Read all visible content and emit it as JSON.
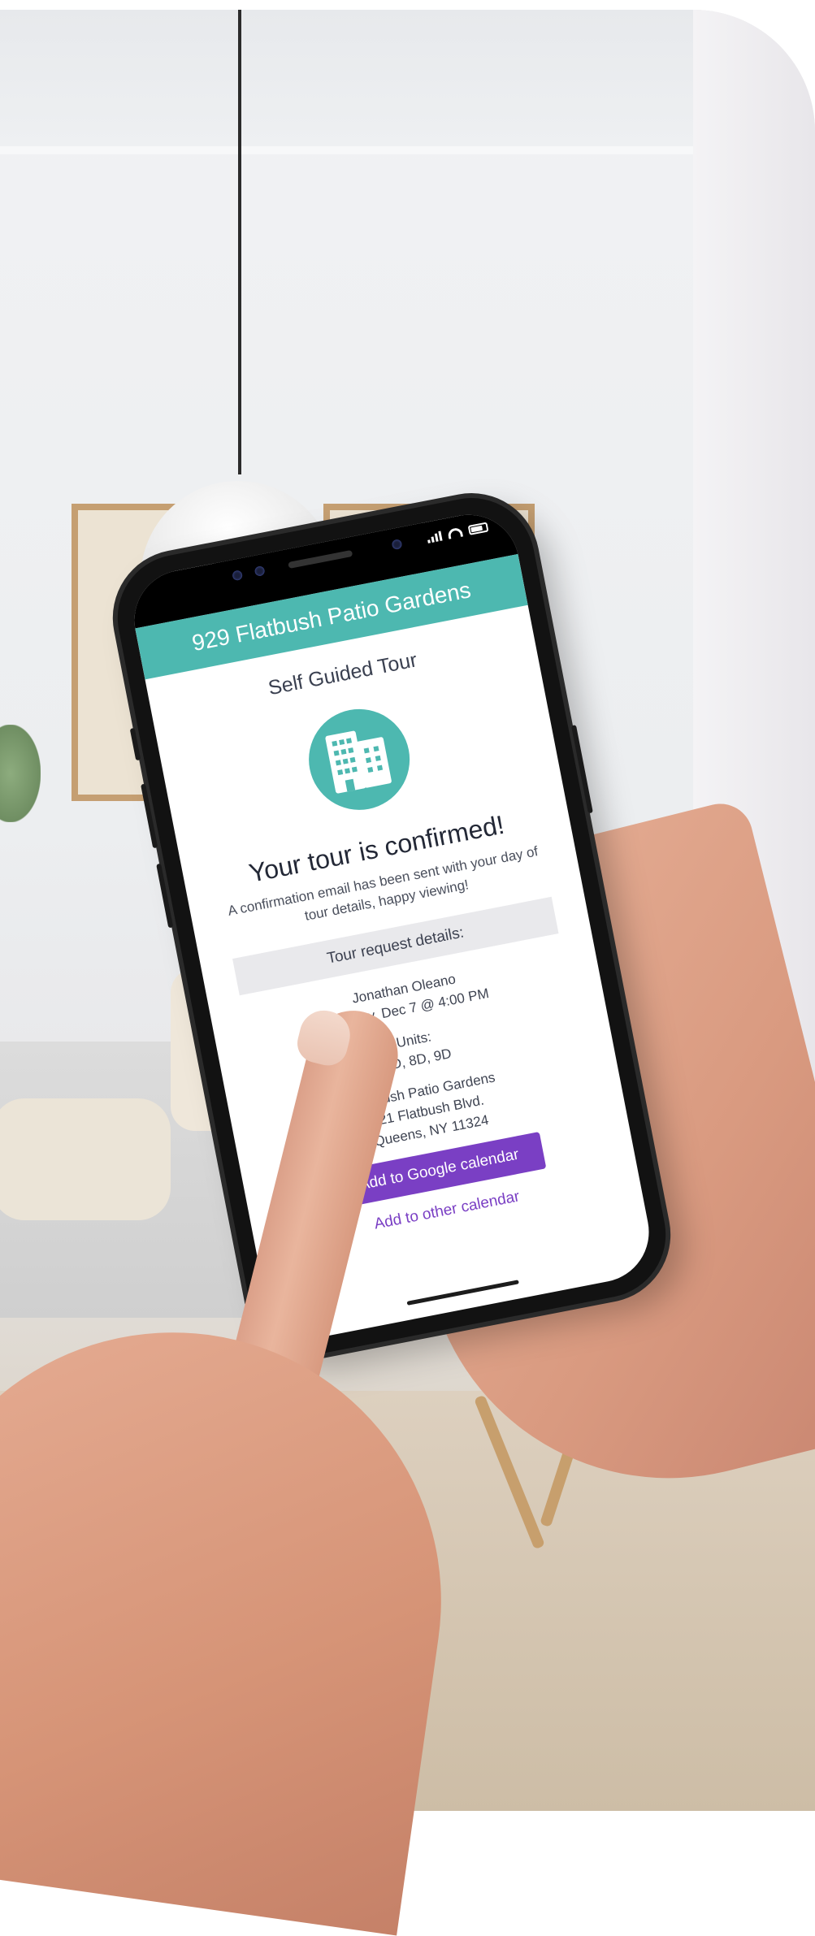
{
  "app": {
    "title": "929 Flatbush Patio Gardens",
    "subtitle": "Self Guided Tour",
    "icon": "building-icon",
    "accent_color": "#4db8b0",
    "button_color": "#7a3fc4"
  },
  "confirmation": {
    "headline": "Your tour is confirmed!",
    "description": "A confirmation email has been sent with your day of tour details, happy viewing!"
  },
  "details": {
    "section_title": "Tour request details:",
    "name": "Jonathan Oleano",
    "datetime": "Monday, Dec 7 @ 4:00 PM",
    "units_label": "Units:",
    "units_value": "7D, 8D, 9D",
    "property_name": "Flatbush Patio Gardens",
    "address_line1": "521 Flatbush Blvd.",
    "address_line2": "Queens, NY 11324"
  },
  "actions": {
    "google_calendar": "Add to Google calendar",
    "other_calendar": "Add to other calendar"
  }
}
